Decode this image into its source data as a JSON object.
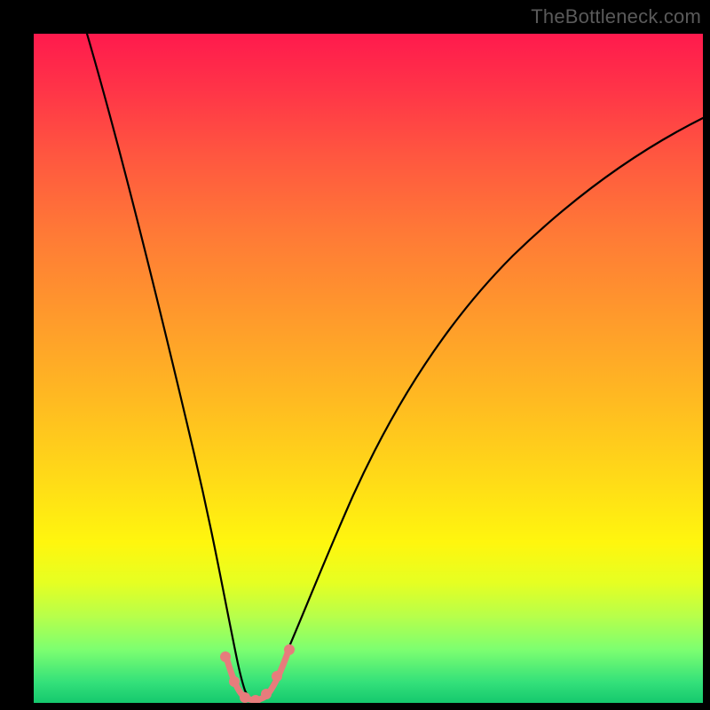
{
  "watermark": "TheBottleneck.com",
  "chart_data": {
    "type": "line",
    "title": "",
    "xlabel": "",
    "ylabel": "",
    "xlim": [
      0,
      100
    ],
    "ylim": [
      0,
      100
    ],
    "grid": false,
    "legend": false,
    "series": [
      {
        "name": "bottleneck-curve",
        "x": [
          8,
          12,
          16,
          20,
          23,
          26,
          28,
          29,
          30,
          31,
          32,
          34,
          36,
          40,
          46,
          54,
          64,
          76,
          90,
          100
        ],
        "y": [
          100,
          80,
          61,
          44,
          30,
          18,
          9,
          4,
          1,
          0.5,
          1,
          4,
          10,
          22,
          37,
          52,
          65,
          76,
          85,
          89
        ]
      }
    ],
    "markers": {
      "name": "highlighted-minimum",
      "x": [
        27.5,
        29,
        30,
        31,
        32,
        33.5,
        35
      ],
      "y": [
        6,
        2,
        0.8,
        0.5,
        1.2,
        4,
        8
      ]
    },
    "colors": {
      "gradient_top": "#ff1a4d",
      "gradient_mid": "#ffd918",
      "gradient_bottom": "#15c86d",
      "curve": "#000000",
      "marker": "#e77c7c",
      "frame": "#000000"
    }
  }
}
